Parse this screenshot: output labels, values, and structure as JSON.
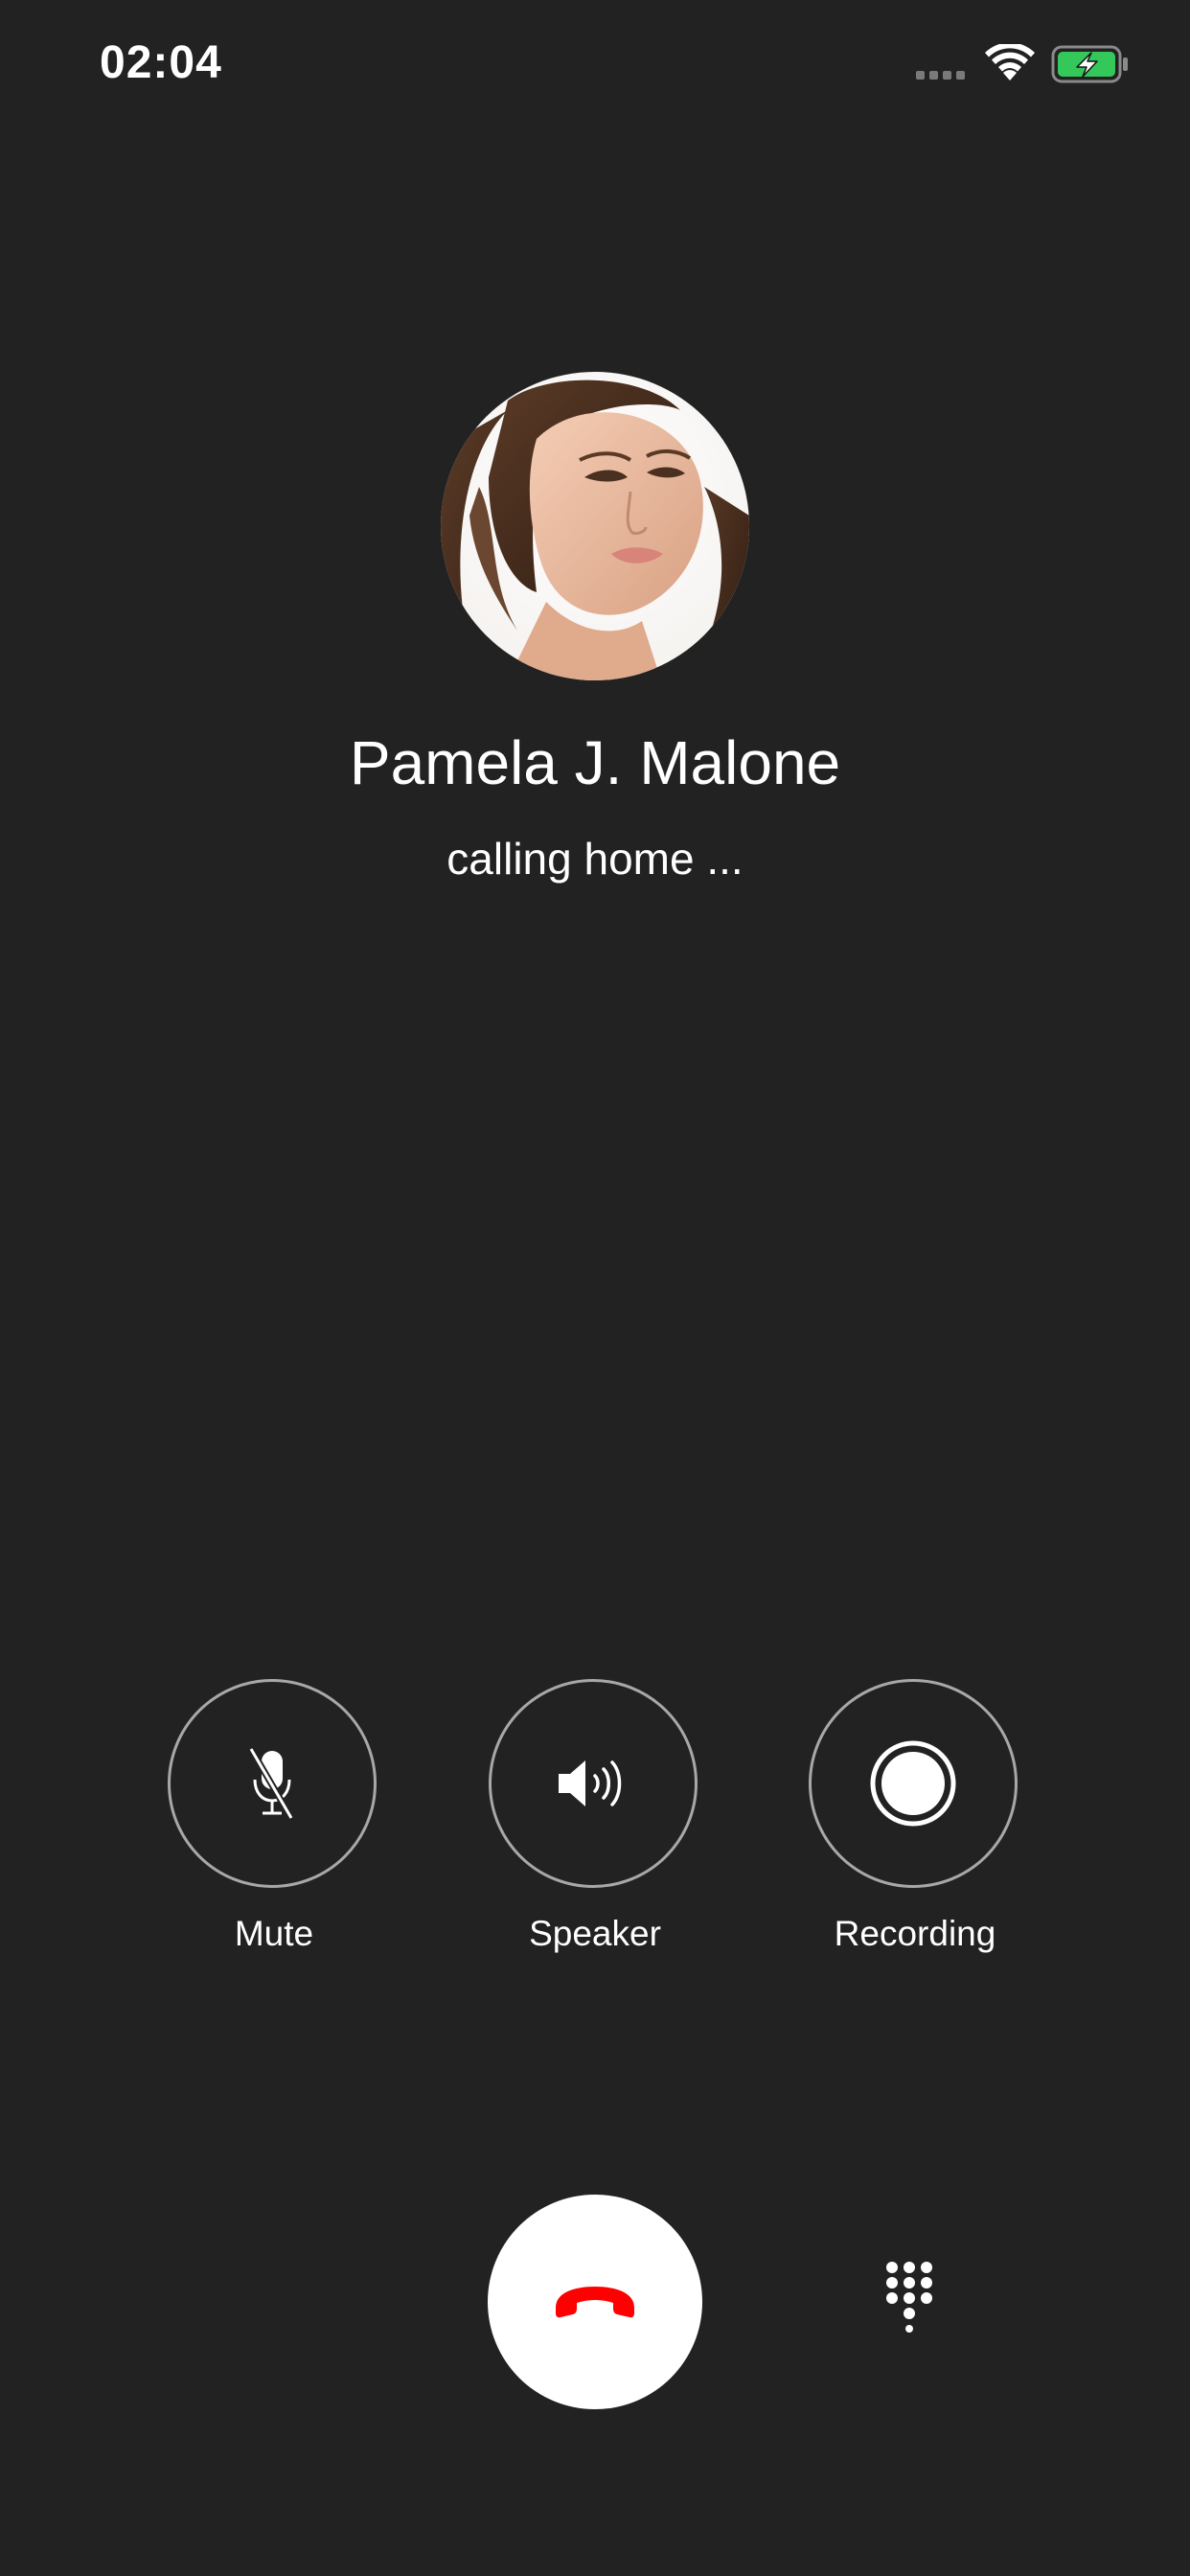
{
  "status_bar": {
    "time": "02:04",
    "icons": [
      "signal-icon",
      "wifi-icon",
      "battery-charging-icon"
    ],
    "battery_color": "#34c759"
  },
  "caller": {
    "name": "Pamela J. Malone",
    "status": "calling home ..."
  },
  "controls": [
    {
      "label": "Mute",
      "icon": "microphone-off-icon"
    },
    {
      "label": "Speaker",
      "icon": "speaker-icon"
    },
    {
      "label": "Recording",
      "icon": "record-icon"
    }
  ],
  "actions": {
    "end_call_icon": "end-call-icon",
    "end_call_color": "#ff0000",
    "keypad_icon": "keypad-icon"
  },
  "theme": {
    "background": "#222222",
    "text": "#ffffff",
    "ring": "#a8a8a8"
  }
}
